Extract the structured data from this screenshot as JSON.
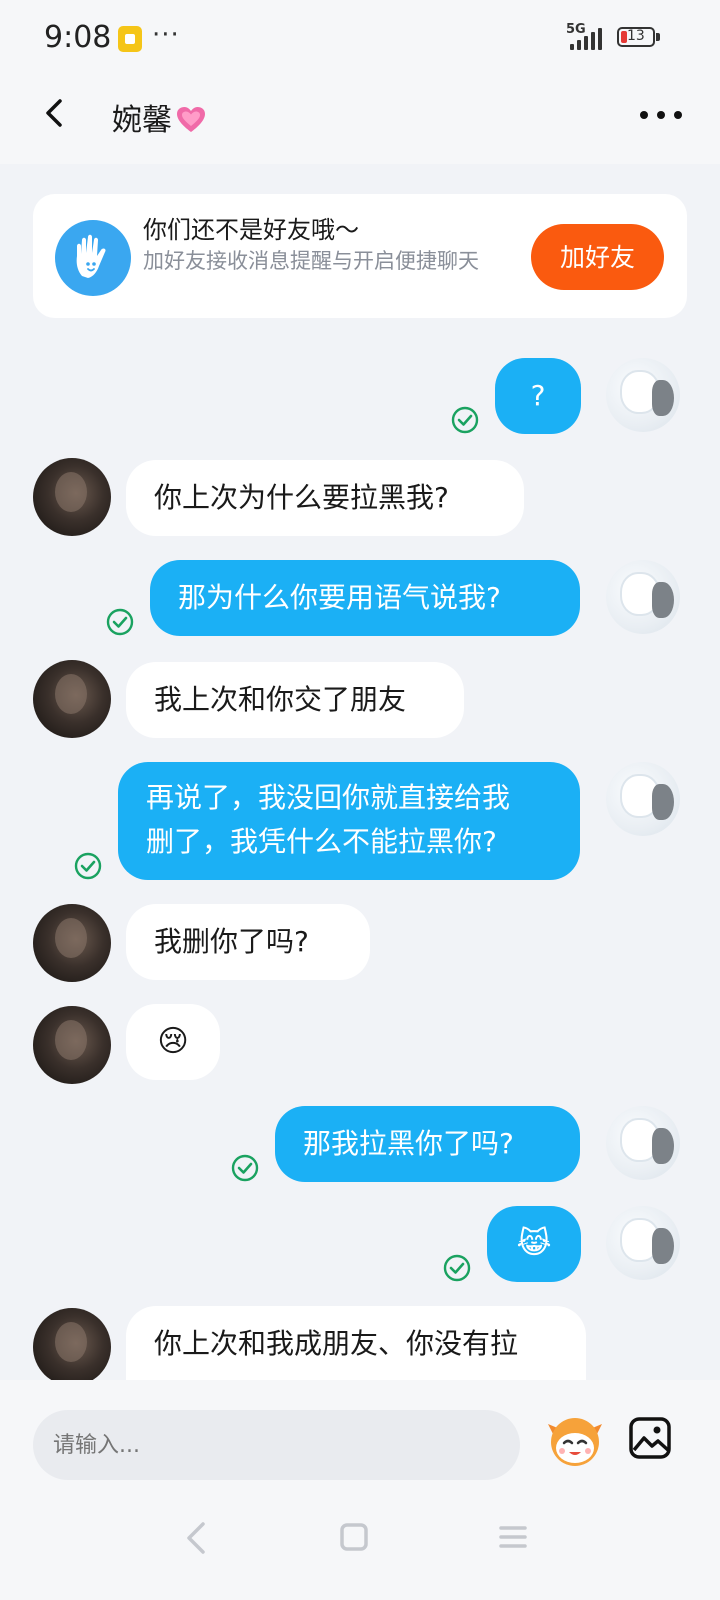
{
  "status_bar": {
    "time": "9:08",
    "more": "···",
    "network": "5G",
    "battery": "13",
    "battery_color": "#e53935"
  },
  "header": {
    "title": "婉馨",
    "title_icon": "growing-heart-icon",
    "back_icon": "chevron-left-icon",
    "menu_icon": "more-horizontal-icon"
  },
  "notice": {
    "icon": "wave-hand-icon",
    "title": "你们还不是好友哦～",
    "subtitle": "加好友接收消息提醒与开启便捷聊天",
    "button": "加好友",
    "button_color": "#fa5a0f"
  },
  "messages": [
    {
      "from": "me",
      "text": "?",
      "read": true
    },
    {
      "from": "her",
      "text": "你上次为什么要拉黑我?"
    },
    {
      "from": "me",
      "text": "那为什么你要用语气说我?",
      "read": true
    },
    {
      "from": "her",
      "text": "我上次和你交了朋友"
    },
    {
      "from": "me",
      "lines": [
        "再说了，我没回你就直接给我",
        "删了，我凭什么不能拉黑你?"
      ],
      "read": true
    },
    {
      "from": "her",
      "text": "我删你了吗?"
    },
    {
      "from": "her",
      "text": "😢"
    },
    {
      "from": "me",
      "text": "那我拉黑你了吗?",
      "read": true
    },
    {
      "from": "me",
      "text": "😹",
      "read": true
    },
    {
      "from": "her",
      "text": "你上次和我成朋友、你没有拉"
    }
  ],
  "input": {
    "placeholder": "请输入...",
    "emoji_icon": "sticker-face-icon",
    "image_icon": "image-icon"
  },
  "nav": {
    "back_icon": "nav-back-icon",
    "home_icon": "nav-home-icon",
    "recents_icon": "nav-recents-icon"
  },
  "colors": {
    "outgoing_bubble": "#1bb0f5",
    "incoming_bubble": "#ffffff",
    "background": "#f1f3f7",
    "read_check": "#1aa260"
  }
}
